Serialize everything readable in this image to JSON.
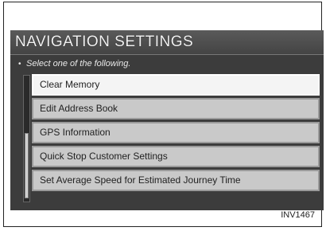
{
  "screen": {
    "title": "NAVIGATION SETTINGS",
    "prompt": "Select one of the following.",
    "menu_items": [
      {
        "label": "Clear Memory",
        "selected": true
      },
      {
        "label": "Edit Address Book",
        "selected": false
      },
      {
        "label": "GPS Information",
        "selected": false
      },
      {
        "label": "Quick Stop Customer Settings",
        "selected": false
      },
      {
        "label": "Set Average Speed for Estimated Journey Time",
        "selected": false
      }
    ]
  },
  "caption": "INV1467"
}
